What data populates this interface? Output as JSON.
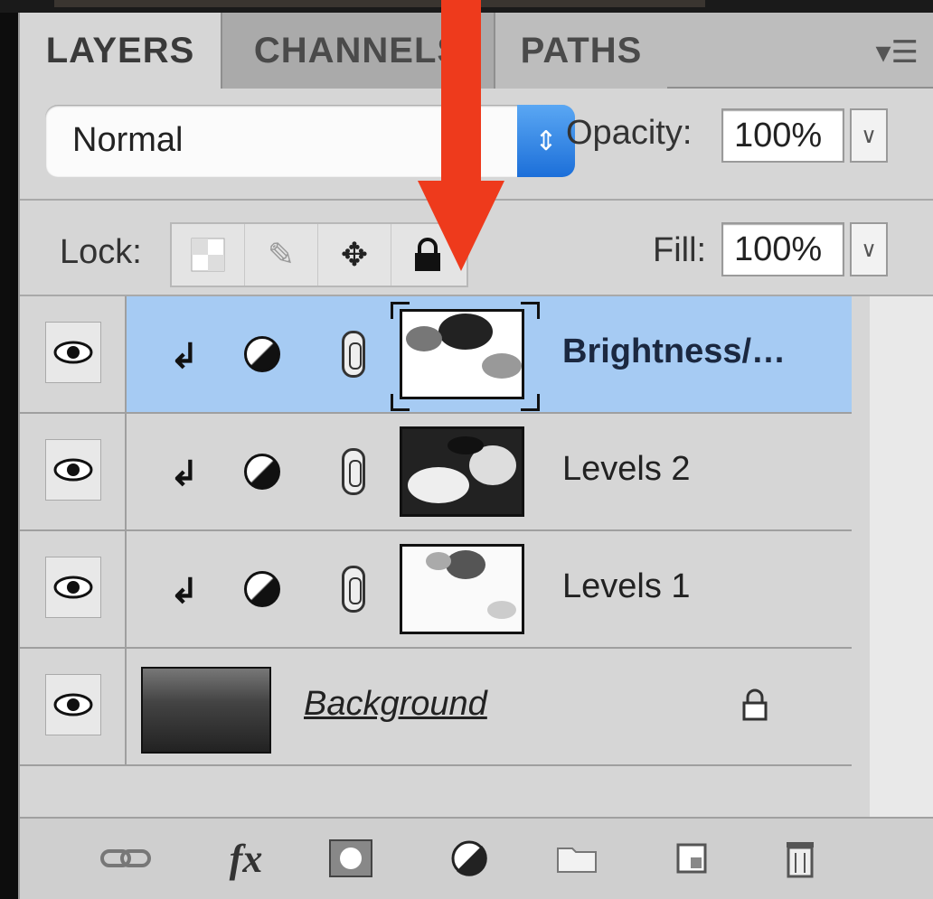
{
  "tabs": [
    "LAYERS",
    "CHANNELS",
    "PATHS"
  ],
  "blend_mode": {
    "value": "Normal"
  },
  "opacity": {
    "label": "Opacity:",
    "value": "100%"
  },
  "lock": {
    "label": "Lock:"
  },
  "fill": {
    "label": "Fill:",
    "value": "100%"
  },
  "layers": [
    {
      "name": "Brightness/…",
      "selected": true,
      "clipped": true
    },
    {
      "name": "Levels 2",
      "selected": false,
      "clipped": true
    },
    {
      "name": "Levels 1",
      "selected": false,
      "clipped": true
    },
    {
      "name": "Background",
      "locked": true
    }
  ],
  "toolbar_icons": [
    "link-icon",
    "fx-icon",
    "mask-icon",
    "adjustment-icon",
    "folder-icon",
    "new-layer-icon",
    "trash-icon"
  ],
  "toolbar": {
    "fx": "fx"
  },
  "colors": {
    "selection": "#a6cbf3",
    "arrow": "#ee3a1c",
    "blend_arrows": "#2b7de4"
  }
}
